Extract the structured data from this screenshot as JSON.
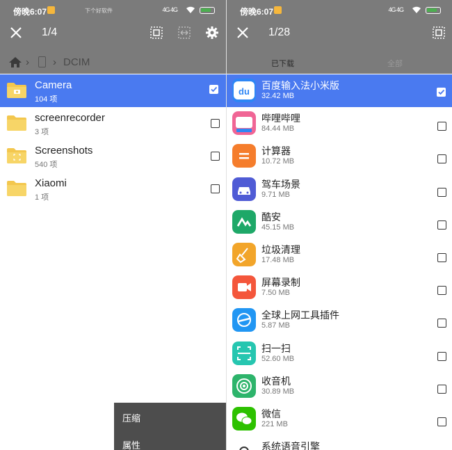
{
  "left": {
    "status": {
      "time": "傍晚6:07",
      "watermark": "下个好软件",
      "signal": "4G 4G"
    },
    "toolbar": {
      "count": "1/4"
    },
    "breadcrumb": {
      "folder": "DCIM"
    },
    "folders": [
      {
        "name": "Camera",
        "count": "104 项",
        "selected": true
      },
      {
        "name": "screenrecorder",
        "count": "3 项",
        "selected": false
      },
      {
        "name": "Screenshots",
        "count": "540 项",
        "selected": false
      },
      {
        "name": "Xiaomi",
        "count": "1 项",
        "selected": false
      }
    ],
    "menu": {
      "compress": "压缩",
      "properties": "属性"
    }
  },
  "right": {
    "status": {
      "time": "傍晚6:07",
      "signal": "4G 4G"
    },
    "toolbar": {
      "count": "1/28"
    },
    "tabs": {
      "downloaded": "已下载",
      "all": "全部"
    },
    "apps": [
      {
        "name": "百度输入法小米版",
        "size": "32.42 MB",
        "color": "#2e86f5",
        "icon": "baidu-input-icon",
        "selected": true
      },
      {
        "name": "哔哩哔哩",
        "size": "84.44 MB",
        "color": "#f06595",
        "icon": "bilibili-icon",
        "selected": false
      },
      {
        "name": "计算器",
        "size": "10.72 MB",
        "color": "#f57d2c",
        "icon": "calculator-icon",
        "selected": false
      },
      {
        "name": "驾车场景",
        "size": "9.71 MB",
        "color": "#4f5bd5",
        "icon": "car-icon",
        "selected": false
      },
      {
        "name": "酷安",
        "size": "45.15 MB",
        "color": "#1ea868",
        "icon": "coolapk-icon",
        "selected": false
      },
      {
        "name": "垃圾清理",
        "size": "17.48 MB",
        "color": "#f2a52a",
        "icon": "broom-icon",
        "selected": false
      },
      {
        "name": "屏幕录制",
        "size": "7.50 MB",
        "color": "#f4563b",
        "icon": "screen-record-icon",
        "selected": false
      },
      {
        "name": "全球上网工具插件",
        "size": "5.87 MB",
        "color": "#2196f3",
        "icon": "plane-icon",
        "selected": false
      },
      {
        "name": "扫一扫",
        "size": "52.60 MB",
        "color": "#26c6b0",
        "icon": "scanner-icon",
        "selected": false
      },
      {
        "name": "收音机",
        "size": "30.89 MB",
        "color": "#2db46b",
        "icon": "radio-icon",
        "selected": false
      },
      {
        "name": "微信",
        "size": "221 MB",
        "color": "#2dc100",
        "icon": "wechat-icon",
        "selected": false
      },
      {
        "name": "系统语音引擎",
        "size": "",
        "color": "#ffffff",
        "icon": "voice-engine-icon",
        "selected": false
      }
    ]
  }
}
